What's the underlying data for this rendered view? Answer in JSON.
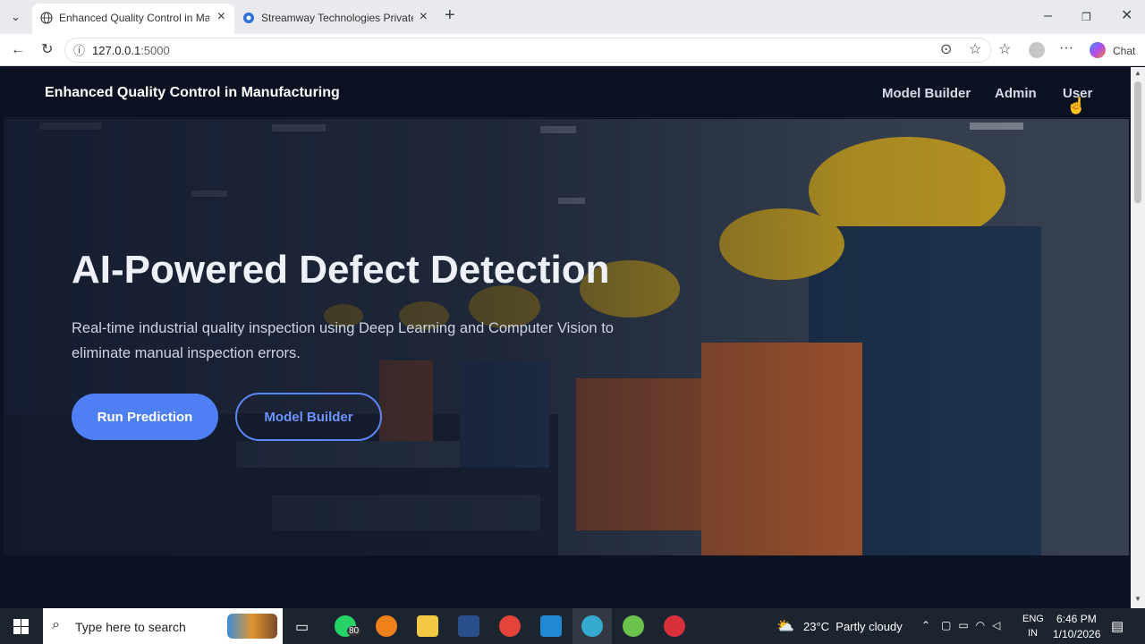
{
  "browser": {
    "tabs": [
      {
        "title": "Enhanced Quality Control in Manu",
        "active": true
      },
      {
        "title": "Streamway Technologies Private Li",
        "active": false
      }
    ],
    "url_host": "127.0.0.1",
    "url_port": ":5000",
    "chat_label": "Chat"
  },
  "nav": {
    "brand": "Enhanced Quality Control in Manufacturing",
    "links": [
      "Model Builder",
      "Admin",
      "User"
    ]
  },
  "hero": {
    "title": "AI-Powered Defect Detection",
    "subtitle": "Real-time industrial quality inspection using Deep Learning and Computer Vision to eliminate manual inspection errors.",
    "primary_button": "Run Prediction",
    "secondary_button": "Model Builder"
  },
  "taskbar": {
    "search_placeholder": "Type here to search",
    "whatsapp_badge": "80",
    "weather": "23°C  Partly cloudy",
    "lang_top": "ENG",
    "lang_bottom": "IN",
    "time": "6:46 PM",
    "date": "1/10/2026"
  },
  "colors": {
    "accent": "#4f7ff5",
    "page_bg": "#0b1222"
  }
}
